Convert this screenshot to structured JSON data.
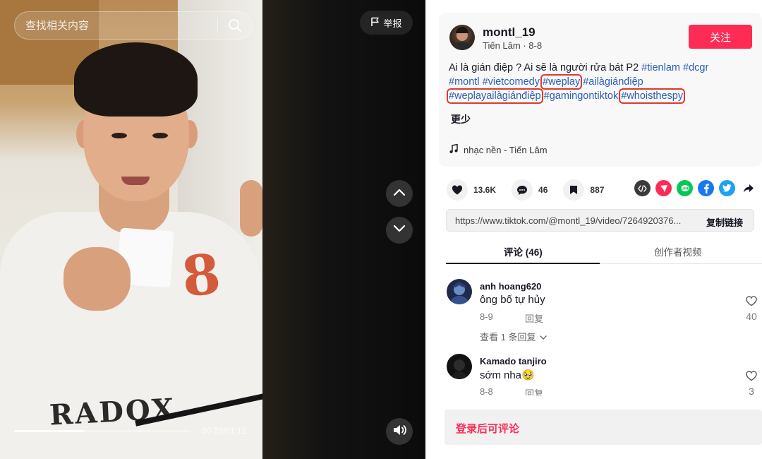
{
  "video": {
    "search_placeholder": "查找相关内容",
    "report_label": "举报",
    "time": "00:29/01:12",
    "progress": 0.4
  },
  "author": {
    "name": "montl_19",
    "sub": "Tiến Lâm · 8-8",
    "follow_label": "关注"
  },
  "description": {
    "text": "Ai là gián điệp ? Ai sẽ là người rửa bát P2",
    "tags": [
      "#tienlam",
      "#dcgr",
      "#montl",
      "#vietcomedy",
      "#weplay",
      "#ailàgiánđiệp",
      "#weplayailàgiánđiệp",
      "#gamingontiktok",
      "#whoisthespy"
    ],
    "less_label": "更少"
  },
  "music": "nhạc nền - Tiến Lâm",
  "stats": {
    "likes": "13.6K",
    "comments": "46",
    "saves": "887"
  },
  "share": {
    "link": "https://www.tiktok.com/@montl_19/video/7264920376...",
    "copy_label": "复制链接"
  },
  "tabs": {
    "comments": "评论 (46)",
    "creator": "创作者视频"
  },
  "comments": [
    {
      "user": "anh hoang620",
      "text": "ông bố tự hủy",
      "date": "8-9",
      "reply": "回复",
      "likes": "40",
      "more": "查看 1 条回复"
    },
    {
      "user": "Kamado tanjiro",
      "text": "sớm nha🥹",
      "date": "8-8",
      "reply": "回复",
      "likes": "3"
    }
  ],
  "login_prompt": "登录后可评论"
}
